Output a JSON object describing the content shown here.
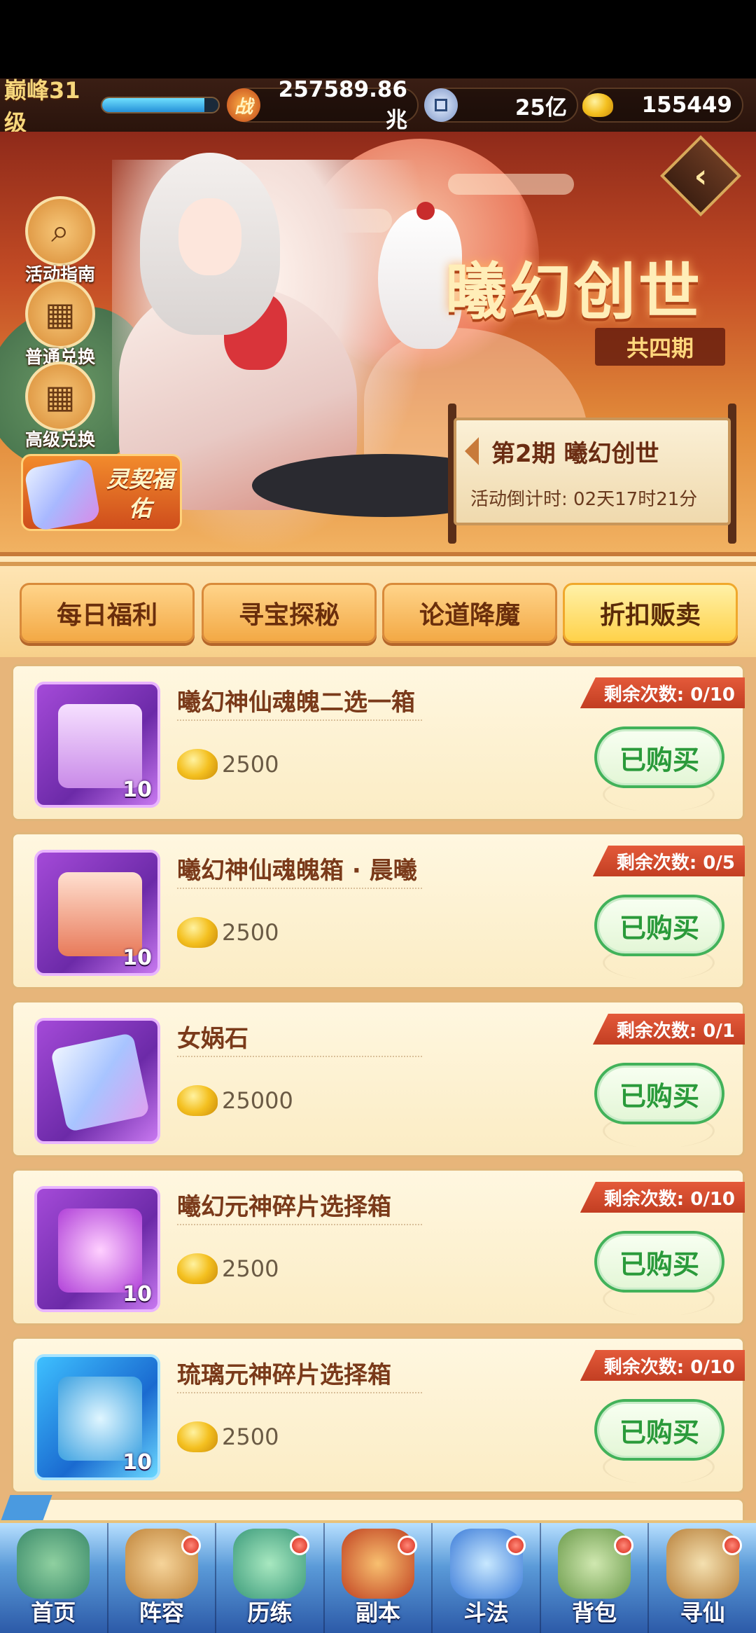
{
  "topbar": {
    "level": "巅峰31级",
    "xp_fraction": 0.88,
    "power": "257589.86兆",
    "power_icon": "战",
    "coins": "25亿",
    "gold": "155449"
  },
  "banner": {
    "title": "曦幻创世",
    "subtitle": "共四期",
    "back_icon": "‹",
    "side_buttons": [
      {
        "label": "活动指南",
        "icon": "magnifier-icon",
        "glyph": "⌕"
      },
      {
        "label": "普通兑换",
        "icon": "gift-icon",
        "glyph": "▦"
      },
      {
        "label": "高级兑换",
        "icon": "gift-icon",
        "glyph": "▦"
      }
    ],
    "lingqi": "灵契福佑",
    "period": {
      "title": "第2期  曦幻创世",
      "countdown": "活动倒计时: 02天17时21分"
    }
  },
  "tabs": [
    {
      "label": "每日福利",
      "active": false
    },
    {
      "label": "寻宝探秘",
      "active": false
    },
    {
      "label": "论道降魔",
      "active": false
    },
    {
      "label": "折扣贩卖",
      "active": true
    }
  ],
  "items": [
    {
      "name": "曦幻神仙魂魄二选一箱",
      "price": "2500",
      "remain": "剩余次数: 0/10",
      "count": "10",
      "button": "已购买",
      "style": "purple"
    },
    {
      "name": "曦幻神仙魂魄箱 · 晨曦",
      "price": "2500",
      "remain": "剩余次数: 0/5",
      "count": "10",
      "button": "已购买",
      "style": "purple"
    },
    {
      "name": "女娲石",
      "price": "25000",
      "remain": "剩余次数: 0/1",
      "count": "",
      "button": "已购买",
      "style": "purple"
    },
    {
      "name": "曦幻元神碎片选择箱",
      "price": "2500",
      "remain": "剩余次数: 0/10",
      "count": "10",
      "button": "已购买",
      "style": "purple"
    },
    {
      "name": "琉璃元神碎片选择箱",
      "price": "2500",
      "remain": "剩余次数: 0/10",
      "count": "10",
      "button": "已购买",
      "style": "blue"
    }
  ],
  "nav": [
    {
      "label": "首页",
      "dot": false
    },
    {
      "label": "阵容",
      "dot": true
    },
    {
      "label": "历练",
      "dot": true
    },
    {
      "label": "副本",
      "dot": true
    },
    {
      "label": "斗法",
      "dot": true
    },
    {
      "label": "背包",
      "dot": true
    },
    {
      "label": "寻仙",
      "dot": true
    }
  ],
  "colors": {
    "accent": "#f3a945",
    "buy_green": "#42b25a",
    "remain_red": "#c23e22"
  }
}
